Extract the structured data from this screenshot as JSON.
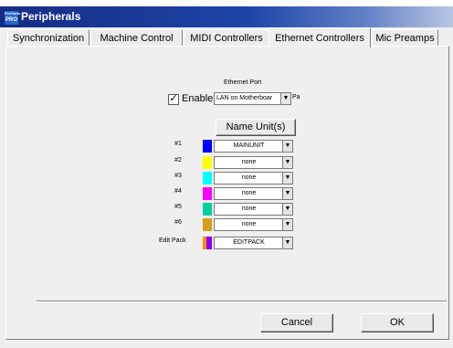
{
  "window": {
    "title": "Peripherals",
    "icon_text_top": "ProTools",
    "icon_text_bottom": "PRO"
  },
  "tabs": [
    {
      "label": "Synchronization",
      "active": false
    },
    {
      "label": "Machine Control",
      "active": false
    },
    {
      "label": "MIDI Controllers",
      "active": false
    },
    {
      "label": "Ethernet Controllers",
      "active": true
    },
    {
      "label": "Mic Preamps",
      "active": false
    }
  ],
  "ethernet_port": {
    "heading": "Ethernet Port",
    "enable_label": "Enable",
    "enabled": true,
    "checkmark": "✓",
    "selected": "LAN on Motherboar",
    "suffix": "Pa"
  },
  "name_units_button": "Name Unit(s)",
  "units": [
    {
      "label": "#1",
      "color": "#0000ff",
      "value": "MAINUNIT"
    },
    {
      "label": "#2",
      "color": "#ffff00",
      "value": "none"
    },
    {
      "label": "#3",
      "color": "#00ffff",
      "value": "none"
    },
    {
      "label": "#4",
      "color": "#ff00ff",
      "value": "none"
    },
    {
      "label": "#5",
      "color": "#00d0a0",
      "value": "none"
    },
    {
      "label": "#6",
      "color": "#d4a017",
      "value": "none"
    }
  ],
  "edit_pack": {
    "label": "Edit Pack",
    "value": "EDITPACK",
    "colors": [
      "#ff8c00",
      "#8b00ff"
    ]
  },
  "dropdown_arrow": "▼",
  "buttons": {
    "cancel": "Cancel",
    "ok": "OK"
  }
}
